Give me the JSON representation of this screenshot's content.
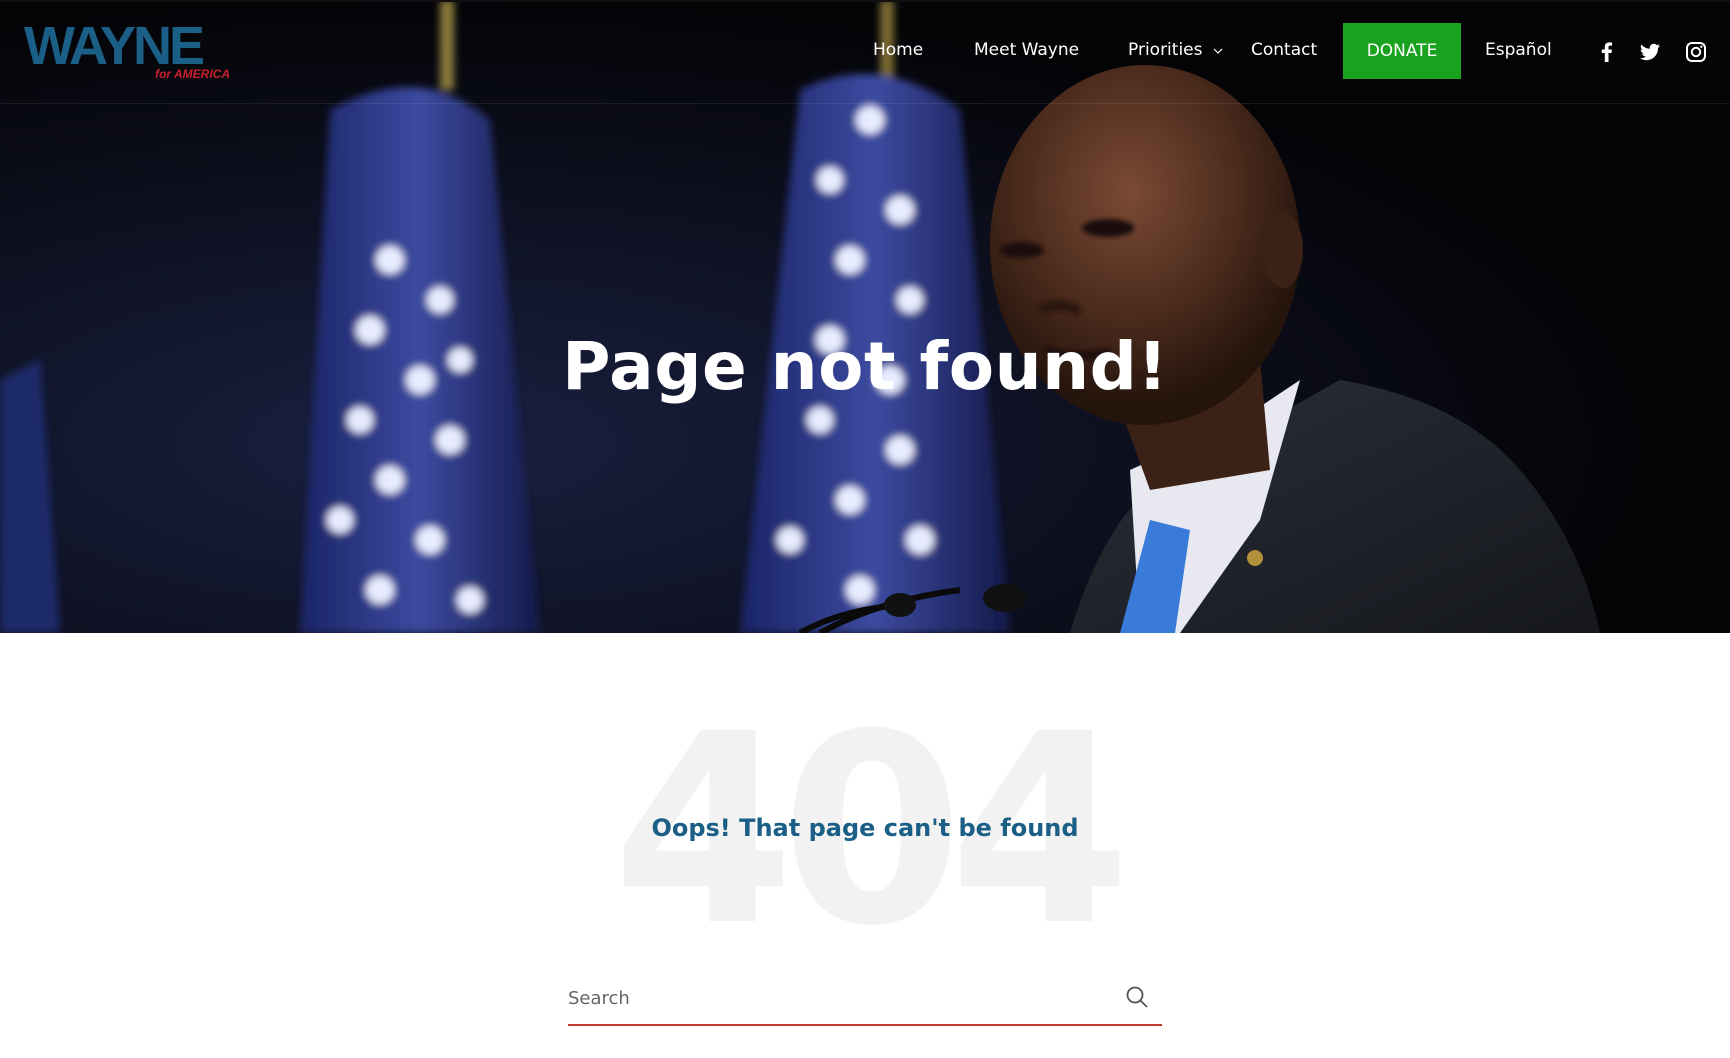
{
  "site": {
    "logo_text": "WAYNE",
    "logo_subtext": "for AMERICA"
  },
  "nav": {
    "items": [
      {
        "label": "Home"
      },
      {
        "label": "Meet Wayne"
      },
      {
        "label": "Priorities"
      },
      {
        "label": "Contact"
      }
    ],
    "donate_label": "DONATE",
    "language_label": "Español",
    "social_icons": [
      "facebook-icon",
      "twitter-icon",
      "instagram-icon"
    ]
  },
  "hero": {
    "title": "Page not found!"
  },
  "error": {
    "code": "404",
    "message": "Oops! That page can't be found"
  },
  "search": {
    "placeholder": "Search"
  },
  "colors": {
    "donate_bg": "#18a21e",
    "logo_blue": "#1b5f86",
    "logo_red": "#c8202c",
    "message_blue": "#1b5f86",
    "search_underline": "#c0392b",
    "code_watermark": "#f2f2f2"
  }
}
